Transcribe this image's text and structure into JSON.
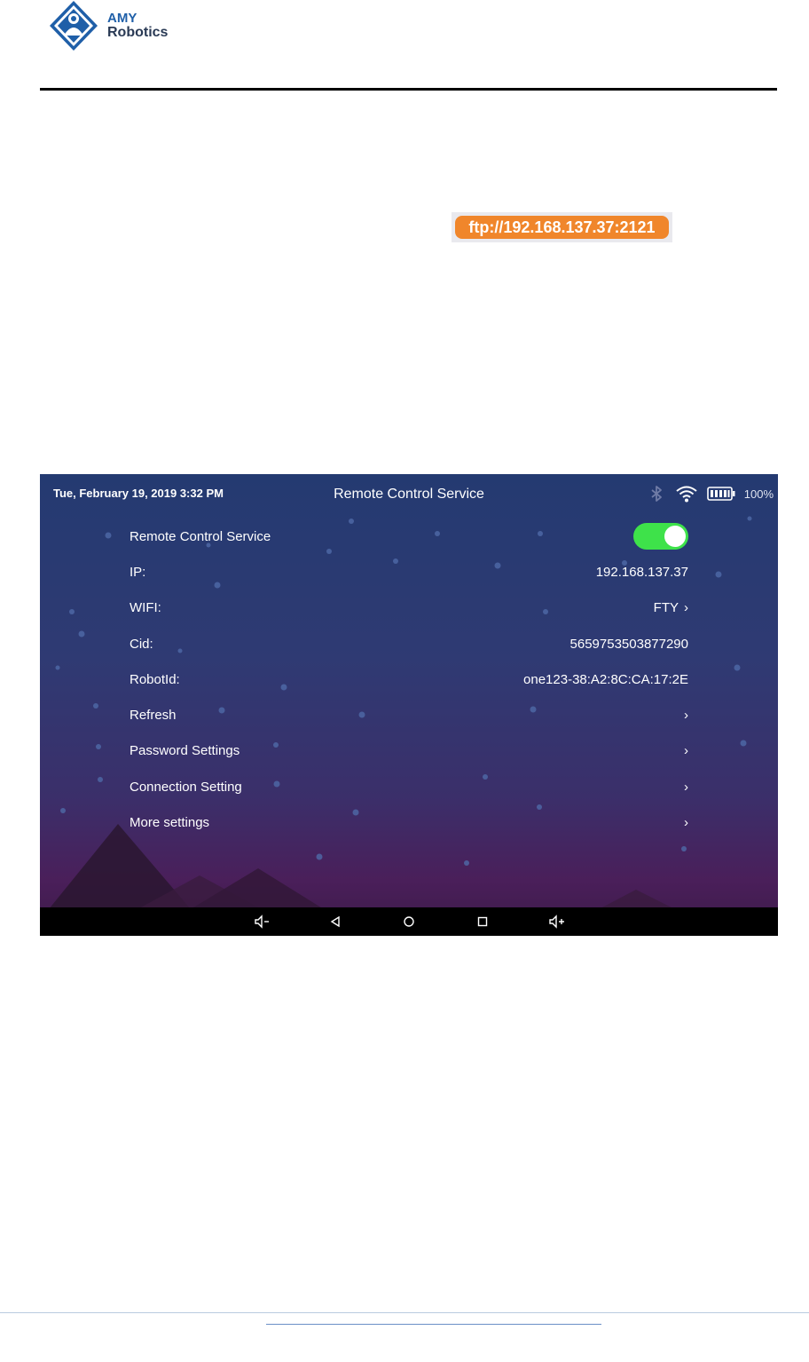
{
  "doc": {
    "logo": {
      "line1": "AMY",
      "line2": "Robotics"
    },
    "ftp_snippet": "ftp://192.168.137.37:2121"
  },
  "device": {
    "status_bar": {
      "datetime": "Tue, February 19, 2019 3:32  PM",
      "title": "Remote Control Service",
      "battery": "100%",
      "icons": [
        "bluetooth-icon",
        "wifi-icon",
        "battery-icon"
      ]
    },
    "settings": {
      "service_toggle": {
        "label": "Remote Control Service",
        "on": true
      },
      "rows": [
        {
          "label": "IP:",
          "value": "192.168.137.37"
        },
        {
          "label": "WIFI:",
          "value": "FTY"
        },
        {
          "label": "Cid:",
          "value": "5659753503877290"
        },
        {
          "label": "RobotId:",
          "value": "one123-38:A2:8C:CA:17:2E"
        },
        {
          "label": "Refresh",
          "value": ""
        },
        {
          "label": "Password Settings",
          "value": ""
        },
        {
          "label": "Connection Setting",
          "value": ""
        },
        {
          "label": "More settings",
          "value": ""
        }
      ],
      "chevron": "›"
    },
    "nav_bar": {
      "buttons": [
        "volume-down-icon",
        "back-icon",
        "home-icon",
        "recents-icon",
        "volume-up-icon"
      ]
    },
    "colors": {
      "toggle_on": "#3ee24a",
      "accent_orange": "#f0862b"
    }
  }
}
